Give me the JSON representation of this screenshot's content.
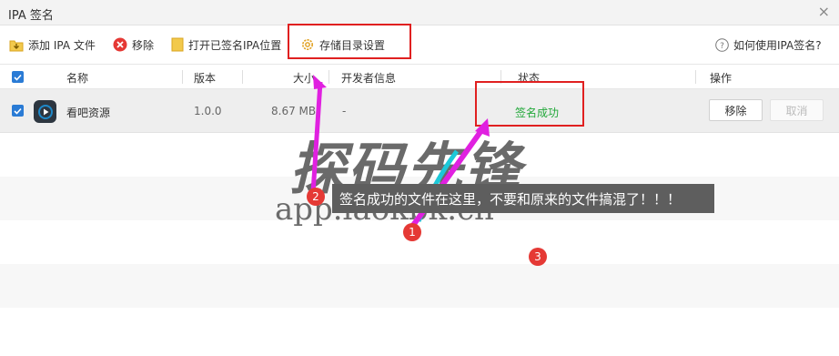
{
  "window": {
    "title": "IPA 签名",
    "close_glyph": "×"
  },
  "toolbar": {
    "add_label": "添加 IPA 文件",
    "remove_label": "移除",
    "open_folder_label": "打开已签名IPA位置",
    "settings_label": "存储目录设置",
    "help_label": "如何使用IPA签名?"
  },
  "table": {
    "columns": {
      "name": "名称",
      "version": "版本",
      "size": "大小",
      "developer": "开发者信息",
      "status": "状态",
      "actions": "操作"
    },
    "rows": [
      {
        "checked": true,
        "name": "看吧资源",
        "version": "1.0.0",
        "size": "8.67 MB",
        "developer": "-",
        "status": "签名成功",
        "remove_label": "移除",
        "cancel_label": "取消"
      }
    ]
  },
  "annotation": {
    "tooltip": "签名成功的文件在这里，不要和原来的文件搞混了！！！",
    "markers": [
      "1",
      "2",
      "3"
    ]
  },
  "watermark": {
    "main": "探码先锋",
    "url": "app.laokbk.cn"
  },
  "colors": {
    "accent": "#2a7bd5",
    "success": "#22a83a",
    "highlight_box": "#e02020",
    "arrow": "#e020e0"
  },
  "icons": {
    "add": "folder-add-icon",
    "remove": "red-x-circle-icon",
    "open": "folder-icon",
    "settings": "gear-icon",
    "help": "question-circle-icon",
    "app": "play-icon"
  }
}
